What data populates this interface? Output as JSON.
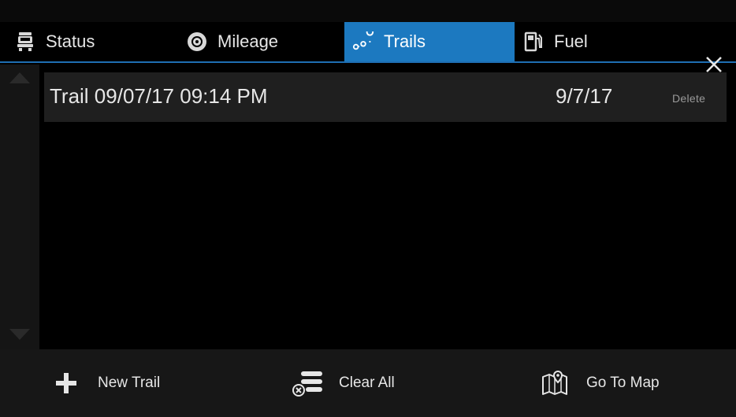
{
  "tabs": [
    {
      "label": "Status",
      "icon": "truck-icon"
    },
    {
      "label": "Mileage",
      "icon": "tire-icon"
    },
    {
      "label": "Trails",
      "icon": "route-pins-icon",
      "active": true
    },
    {
      "label": "Fuel",
      "icon": "fuel-pump-icon"
    }
  ],
  "trails": [
    {
      "name": "Trail 09/07/17 09:14 PM",
      "date": "9/7/17",
      "delete_label": "Delete"
    }
  ],
  "bottom_bar": {
    "new_trail": "New Trail",
    "clear_all": "Clear All",
    "go_to_map": "Go To Map"
  },
  "colors": {
    "accent": "#1c79c0",
    "background": "#000000",
    "row": "#1f1f1f",
    "bottom_bar": "#171717"
  }
}
